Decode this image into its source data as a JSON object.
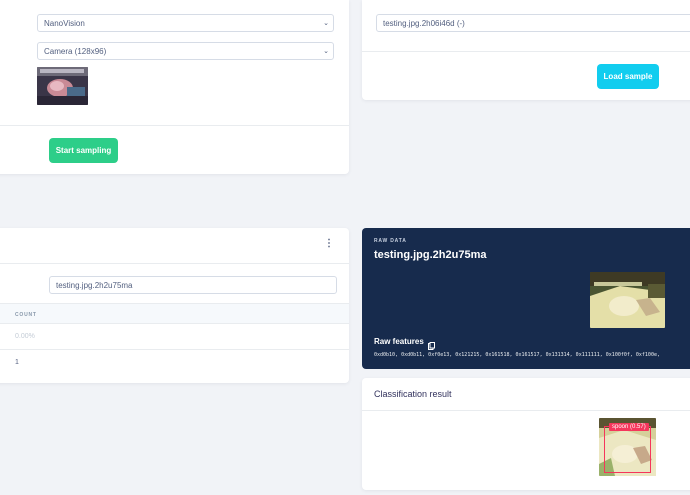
{
  "sampling": {
    "device_select": "NanoVision",
    "sensor_select": "Camera (128x96)",
    "start_button": "Start sampling"
  },
  "load": {
    "sample_select": "testing.jpg.2h06i46d (-)",
    "load_button": "Load sample"
  },
  "results": {
    "menu_icon": "⋮",
    "sample_name": "testing.jpg.2h2u75ma",
    "count_header": "COUNT",
    "row1_value": "0.00%",
    "row2_value": "1"
  },
  "raw": {
    "overline": "RAW DATA",
    "title": "testing.jpg.2h2u75ma",
    "features_label": "Raw features",
    "features_values": "0xd0b10, 0xd0b11, 0xf0e13, 0x121215, 0x161518, 0x161517, 0x131314, 0x111111, 0x100f0f, 0xf100e,"
  },
  "classification": {
    "title": "Classification result",
    "detection_label": "spoon (0.57)"
  },
  "colors": {
    "green": "#2dce89",
    "cyan": "#11cdef",
    "dark_navy": "#172b4d",
    "detection_red": "#f5365c"
  }
}
